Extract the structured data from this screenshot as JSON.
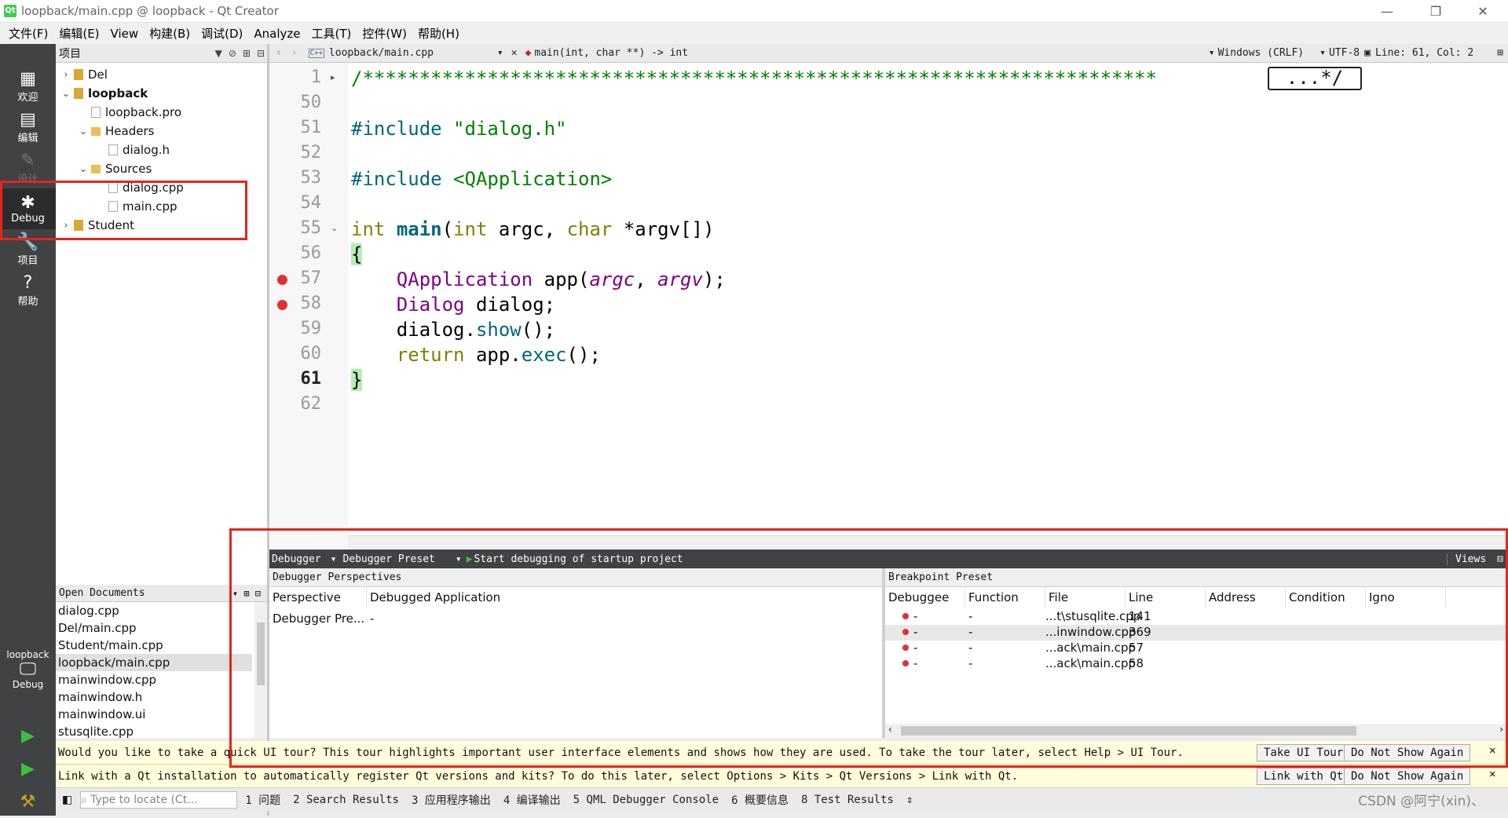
{
  "window": {
    "title": "loopback/main.cpp @ loopback - Qt Creator",
    "app_icon": "Qt",
    "minimize": "—",
    "restore": "❐",
    "close": "✕"
  },
  "menu": [
    "文件(F)",
    "编辑(E)",
    "View",
    "构建(B)",
    "调试(D)",
    "Analyze",
    "工具(T)",
    "控件(W)",
    "帮助(H)"
  ],
  "modes": [
    {
      "label": "欢迎",
      "icon": "grid-icon"
    },
    {
      "label": "编辑",
      "icon": "edit-icon"
    },
    {
      "label": "设计",
      "icon": "pencil-icon"
    },
    {
      "label": "Debug",
      "icon": "bug-icon"
    },
    {
      "label": "项目",
      "icon": "wrench-icon"
    },
    {
      "label": "帮助",
      "icon": "help-icon"
    }
  ],
  "kit": {
    "project": "loopback",
    "mode": "Debug"
  },
  "project_panel": {
    "title": "项目"
  },
  "tree": [
    {
      "label": "Del",
      "depth": 0,
      "arrow": "›",
      "type": "proj"
    },
    {
      "label": "loopback",
      "depth": 0,
      "arrow": "⌄",
      "type": "proj",
      "bold": true
    },
    {
      "label": "loopback.pro",
      "depth": 1,
      "arrow": "",
      "type": "file"
    },
    {
      "label": "Headers",
      "depth": 1,
      "arrow": "⌄",
      "type": "folder"
    },
    {
      "label": "dialog.h",
      "depth": 2,
      "arrow": "",
      "type": "file"
    },
    {
      "label": "Sources",
      "depth": 1,
      "arrow": "⌄",
      "type": "folder"
    },
    {
      "label": "dialog.cpp",
      "depth": 2,
      "arrow": "",
      "type": "file"
    },
    {
      "label": "main.cpp",
      "depth": 2,
      "arrow": "",
      "type": "file"
    },
    {
      "label": "Student",
      "depth": 0,
      "arrow": "›",
      "type": "proj"
    }
  ],
  "editor_header": {
    "file": "loopback/main.cpp",
    "symbol": "main(int, char **) -> int",
    "line_ending": "Windows (CRLF)",
    "encoding": "UTF-8",
    "position": "Line: 61, Col: 2"
  },
  "code": {
    "line_numbers": [
      "1",
      "50",
      "51",
      "52",
      "53",
      "54",
      "55",
      "56",
      "57",
      "58",
      "59",
      "60",
      "61",
      "62"
    ],
    "current_line": "61",
    "breakpoint_lines": [
      "57",
      "58"
    ],
    "fold_marks": [
      "▸",
      "⌄"
    ],
    "header_comment": "/**********************************************************************",
    "header_comment_end": "...*/",
    "include1_kw": "#include",
    "include1_file": "\"dialog.h\"",
    "include2_kw": "#include",
    "include2_file": "<QApplication>",
    "main_ret": "int",
    "main_name": "main",
    "main_p1_type": "int",
    "main_p1": "argc,",
    "main_p2_type": "char",
    "main_p2": "*argv[])",
    "open_brace": "{",
    "close_brace": "}",
    "l57_cls": "QApplication",
    "l57_var": "app(",
    "l57_a1": "argc",
    "l57_a2": "argv",
    "l57_end": ");",
    "l58_cls": "Dialog",
    "l58_var": "dialog;",
    "l59_obj": "dialog.",
    "l59_fn": "show",
    "l59_end": "();",
    "l60_kw": "return",
    "l60_obj": "app.",
    "l60_fn": "exec",
    "l60_end": "();"
  },
  "debug_toolbar": {
    "debugger": "Debugger",
    "preset": "Debugger Preset",
    "start": "Start debugging of startup project",
    "views": "Views"
  },
  "perspectives": {
    "title": "Debugger Perspectives",
    "columns": [
      "Perspective",
      "Debugged Application"
    ],
    "rows": [
      [
        "Debugger Pre...",
        "-"
      ]
    ]
  },
  "breakpoints": {
    "title": "Breakpoint Preset",
    "columns": [
      "Debuggee",
      "Function",
      "File",
      "Line",
      "Address",
      "Condition",
      "Igno"
    ],
    "rows": [
      {
        "debuggee": "-",
        "function": "-",
        "file": "...t\\stusqlite.cpp",
        "line": "141"
      },
      {
        "debuggee": "-",
        "function": "-",
        "file": "...inwindow.cpp",
        "line": "369"
      },
      {
        "debuggee": "-",
        "function": "-",
        "file": "...ack\\main.cpp",
        "line": "57"
      },
      {
        "debuggee": "-",
        "function": "-",
        "file": "...ack\\main.cpp",
        "line": "58"
      }
    ]
  },
  "open_documents": {
    "title": "Open Documents",
    "items": [
      "dialog.cpp",
      "Del/main.cpp",
      "Student/main.cpp",
      "loopback/main.cpp",
      "mainwindow.cpp",
      "mainwindow.h",
      "mainwindow.ui",
      "stusqlite.cpp"
    ],
    "selected": "loopback/main.cpp"
  },
  "infobars": [
    {
      "text": "Would you like to take a quick UI tour? This tour highlights important user interface elements and shows how they are used. To take the tour later, select Help > UI Tour.",
      "btn1": "Take UI Tour",
      "btn2": "Do Not Show Again"
    },
    {
      "text": "Link with a Qt installation to automatically register Qt versions and kits? To do this later, select Options > Kits > Qt Versions > Link with Qt.",
      "btn1": "Link with Qt",
      "btn2": "Do Not Show Again"
    }
  ],
  "statusbar": {
    "locator_placeholder": "Type to locate (Ct...",
    "panes": [
      "1 问题",
      "2 Search Results",
      "3 应用程序输出",
      "4 编译输出",
      "5 QML Debugger Console",
      "6 概要信息",
      "8 Test Results"
    ],
    "watermark": "CSDN @阿宁(xin)、"
  },
  "colors": {
    "highlight_box": "#e8231c",
    "sidebar": "#404244",
    "keyword": "#808000",
    "string": "#008000",
    "class": "#800080",
    "breakpoint": "#e23030"
  }
}
